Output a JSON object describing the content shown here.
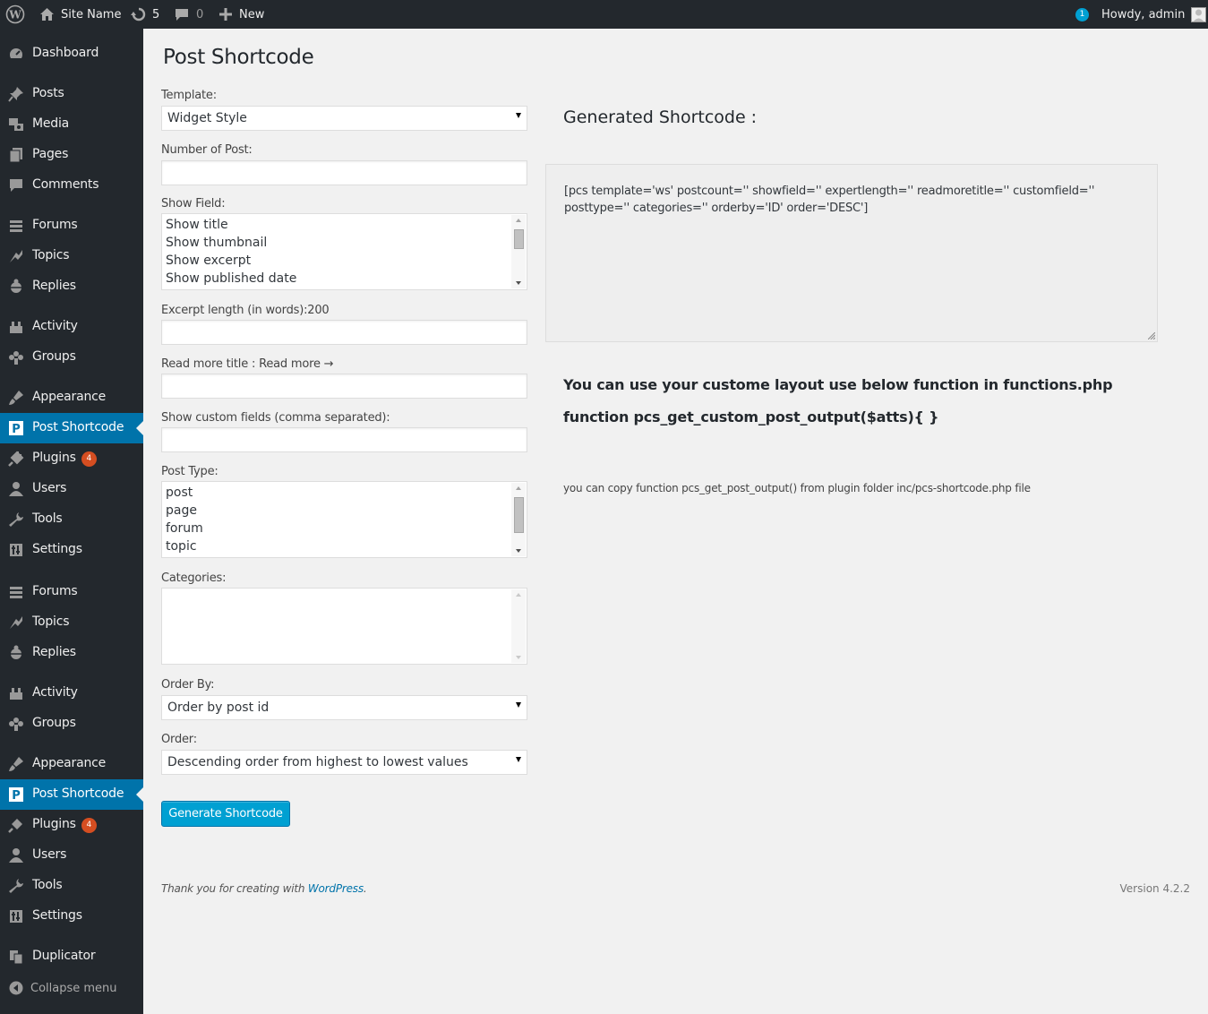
{
  "adminbar": {
    "site_name": "Site Name",
    "updates_count": "5",
    "comments_count": "0",
    "new_label": "New",
    "notification_count": "1",
    "howdy": "Howdy, admin"
  },
  "sidebar": {
    "items": [
      {
        "label": "Dashboard",
        "icon": "dashboard-icon"
      },
      {
        "label": "Posts",
        "icon": "pin-icon"
      },
      {
        "label": "Media",
        "icon": "media-icon"
      },
      {
        "label": "Pages",
        "icon": "pages-icon"
      },
      {
        "label": "Comments",
        "icon": "comment-icon"
      },
      {
        "label": "Forums",
        "icon": "forums-icon"
      },
      {
        "label": "Topics",
        "icon": "topics-icon"
      },
      {
        "label": "Replies",
        "icon": "replies-icon"
      },
      {
        "label": "Activity",
        "icon": "activity-icon"
      },
      {
        "label": "Groups",
        "icon": "groups-icon"
      },
      {
        "label": "Appearance",
        "icon": "appearance-icon"
      },
      {
        "label": "Post Shortcode",
        "icon": "post-shortcode-icon"
      },
      {
        "label": "Plugins",
        "icon": "plugins-icon",
        "badge": "4"
      },
      {
        "label": "Users",
        "icon": "users-icon"
      },
      {
        "label": "Tools",
        "icon": "tools-icon"
      },
      {
        "label": "Settings",
        "icon": "settings-icon"
      },
      {
        "label": "Forums",
        "icon": "forums-icon"
      },
      {
        "label": "Topics",
        "icon": "topics-icon"
      },
      {
        "label": "Replies",
        "icon": "replies-icon"
      },
      {
        "label": "Activity",
        "icon": "activity-icon"
      },
      {
        "label": "Groups",
        "icon": "groups-icon"
      },
      {
        "label": "Appearance",
        "icon": "appearance-icon"
      },
      {
        "label": "Post Shortcode",
        "icon": "post-shortcode-icon"
      },
      {
        "label": "Plugins",
        "icon": "plugins-icon",
        "badge": "4"
      },
      {
        "label": "Users",
        "icon": "users-icon"
      },
      {
        "label": "Tools",
        "icon": "tools-icon"
      },
      {
        "label": "Settings",
        "icon": "settings-icon"
      },
      {
        "label": "Duplicator",
        "icon": "duplicator-icon"
      }
    ],
    "collapse_label": "Collapse menu"
  },
  "form": {
    "title": "Post Shortcode",
    "template_label": "Template:",
    "template_value": "Widget Style",
    "number_label": "Number of Post:",
    "number_value": "",
    "show_field_label": "Show Field:",
    "show_field_options": [
      "Show title",
      "Show thumbnail",
      "Show excerpt",
      "Show published date"
    ],
    "excerpt_label": "Excerpt length (in words):200",
    "excerpt_value": "",
    "readmore_label": "Read more title : Read more →",
    "readmore_value": "",
    "custom_fields_label": "Show custom fields (comma separated):",
    "custom_fields_value": "",
    "post_type_label": "Post Type:",
    "post_type_options": [
      "post",
      "page",
      "forum",
      "topic"
    ],
    "categories_label": "Categories:",
    "order_by_label": "Order By:",
    "order_by_value": "Order by post id",
    "order_label": "Order:",
    "order_value": "Descending order from highest to lowest values",
    "generate_button": "Generate Shortcode"
  },
  "output": {
    "title": "Generated Shortcode :",
    "shortcode": "[pcs template='ws' postcount='' showfield='' expertlength='' readmoretitle='' customfield='' posttype='' categories='' orderby='ID' order='DESC']",
    "info_line1": "You can use your custome layout use below function in functions.php",
    "info_line2": "function pcs_get_custom_post_output($atts){ }",
    "info_line3": "you can copy function pcs_get_post_output() from plugin folder inc/pcs-shortcode.php file"
  },
  "footer": {
    "thanks_prefix": "Thank you for creating with",
    "thanks_link": "WordPress",
    "thanks_suffix": ".",
    "version": "Version 4.2.2"
  },
  "colors": {
    "adminbar_bg": "#23282d",
    "accent": "#0073aa",
    "button": "#00a0d2",
    "badge": "#d54e21"
  }
}
